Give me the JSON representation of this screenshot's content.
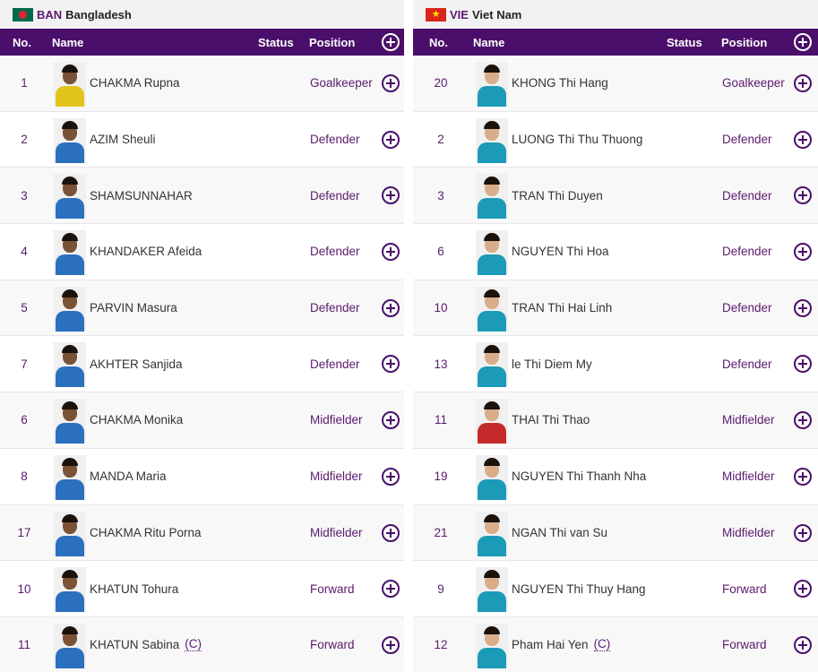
{
  "columns": {
    "no": "No.",
    "name": "Name",
    "status": "Status",
    "position": "Position"
  },
  "colors": {
    "header_bg": "#4a0f6a",
    "accent": "#5a1a6e"
  },
  "teams": [
    {
      "code": "BAN",
      "name": "Bangladesh",
      "flag_icon": "bangladesh-flag-icon",
      "players": [
        {
          "no": "1",
          "name": "CHAKMA Rupna",
          "position": "Goalkeeper",
          "captain": ""
        },
        {
          "no": "2",
          "name": "AZIM Sheuli",
          "position": "Defender",
          "captain": ""
        },
        {
          "no": "3",
          "name": "SHAMSUNNAHAR",
          "position": "Defender",
          "captain": ""
        },
        {
          "no": "4",
          "name": "KHANDAKER Afeida",
          "position": "Defender",
          "captain": ""
        },
        {
          "no": "5",
          "name": "PARVIN Masura",
          "position": "Defender",
          "captain": ""
        },
        {
          "no": "7",
          "name": "AKHTER Sanjida",
          "position": "Defender",
          "captain": ""
        },
        {
          "no": "6",
          "name": "CHAKMA Monika",
          "position": "Midfielder",
          "captain": ""
        },
        {
          "no": "8",
          "name": "MANDA Maria",
          "position": "Midfielder",
          "captain": ""
        },
        {
          "no": "17",
          "name": "CHAKMA Ritu Porna",
          "position": "Midfielder",
          "captain": ""
        },
        {
          "no": "10",
          "name": "KHATUN Tohura",
          "position": "Forward",
          "captain": ""
        },
        {
          "no": "11",
          "name": "KHATUN Sabina",
          "position": "Forward",
          "captain": "(C)"
        }
      ]
    },
    {
      "code": "VIE",
      "name": "Viet Nam",
      "flag_icon": "vietnam-flag-icon",
      "players": [
        {
          "no": "20",
          "name": "KHONG Thi Hang",
          "position": "Goalkeeper",
          "captain": ""
        },
        {
          "no": "2",
          "name": "LUONG Thi Thu Thuong",
          "position": "Defender",
          "captain": ""
        },
        {
          "no": "3",
          "name": "TRAN Thi Duyen",
          "position": "Defender",
          "captain": ""
        },
        {
          "no": "6",
          "name": "NGUYEN Thi Hoa",
          "position": "Defender",
          "captain": ""
        },
        {
          "no": "10",
          "name": "TRAN Thi Hai Linh",
          "position": "Defender",
          "captain": ""
        },
        {
          "no": "13",
          "name": "le Thi Diem My",
          "position": "Defender",
          "captain": ""
        },
        {
          "no": "11",
          "name": "THAI Thi Thao",
          "position": "Midfielder",
          "captain": ""
        },
        {
          "no": "19",
          "name": "NGUYEN Thi Thanh Nha",
          "position": "Midfielder",
          "captain": ""
        },
        {
          "no": "21",
          "name": "NGAN Thi van Su",
          "position": "Midfielder",
          "captain": ""
        },
        {
          "no": "9",
          "name": "NGUYEN Thi Thuy Hang",
          "position": "Forward",
          "captain": ""
        },
        {
          "no": "12",
          "name": "Pham Hai Yen",
          "position": "Forward",
          "captain": "(C)"
        }
      ]
    }
  ]
}
